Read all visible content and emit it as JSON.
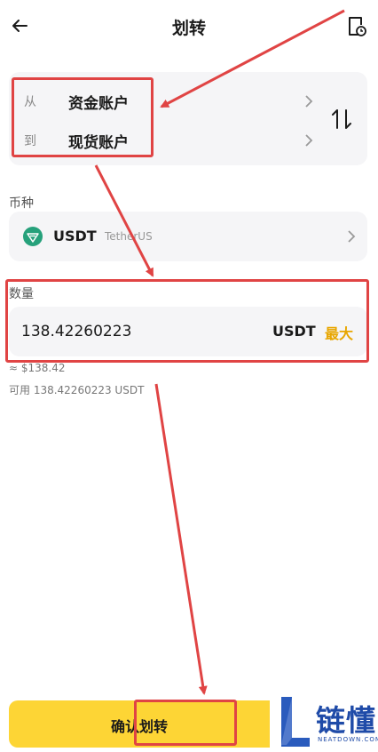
{
  "header": {
    "title": "划转"
  },
  "transfer": {
    "from_label": "从",
    "from_value": "资金账户",
    "to_label": "到",
    "to_value": "现货账户"
  },
  "coin": {
    "section_label": "币种",
    "symbol": "USDT",
    "name": "TetherUS"
  },
  "quantity": {
    "section_label": "数量",
    "value": "138.42260223",
    "unit": "USDT",
    "max_label": "最大",
    "approx": "≈ $138.42",
    "available": "可用 138.42260223 USDT"
  },
  "confirm_button": {
    "label": "确认划转"
  },
  "watermark": {
    "text": "链懂",
    "subtext": "NEATDOWN.COM"
  },
  "colors": {
    "accent_yellow": "#fdd535",
    "max_text": "#e8a600",
    "tether_green": "#26a17b",
    "annotation_red": "#e04444",
    "logo_blue": "#1f4ba8"
  }
}
